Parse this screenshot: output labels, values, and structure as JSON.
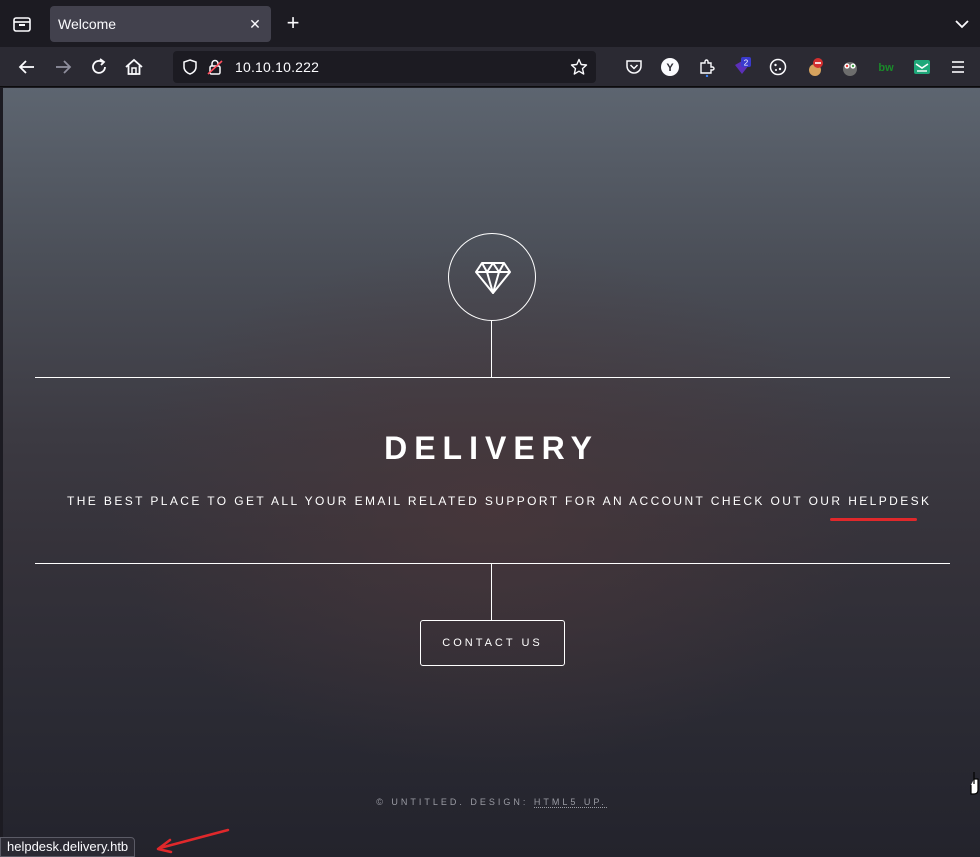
{
  "tab": {
    "title": "Welcome",
    "close": "✕"
  },
  "tabbar": {
    "new_tab": "+"
  },
  "urlbar": {
    "url": "10.10.10.222"
  },
  "extensions": {
    "badge_count": "2"
  },
  "site": {
    "title": "DELIVERY",
    "tagline_prefix": "THE BEST PLACE TO GET ALL YOUR EMAIL RELATED SUPPORT FOR AN ACCOUNT CHECK OUT OUR",
    "helpdesk_label": "HELPDESK",
    "contact_button": "CONTACT US",
    "footer_copyright": "© UNTITLED. DESIGN:",
    "footer_design_link": "HTML5 UP."
  },
  "status": {
    "link_preview": "helpdesk.delivery.htb"
  },
  "colors": {
    "chrome_dark": "#1c1b22",
    "toolbar": "#2b2a33",
    "tab_selected": "#42414d",
    "annotation_red": "#e0282b"
  },
  "icons": {
    "tab_list": "tab-list-icon",
    "back": "back-arrow-icon",
    "forward": "forward-arrow-icon",
    "reload": "reload-icon",
    "home": "home-icon",
    "shield": "tracking-shield-icon",
    "lock": "insecure-lock-icon",
    "bookmark": "star-icon",
    "gem": "diamond-icon"
  }
}
